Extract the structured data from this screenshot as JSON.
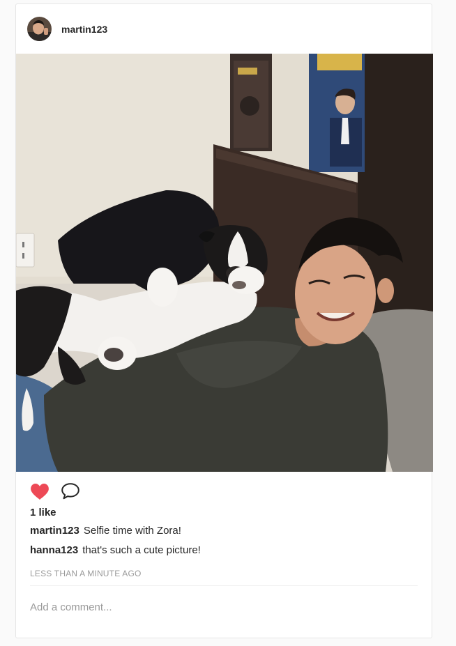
{
  "post": {
    "username": "martin123",
    "avatar_icon": "profile-photo",
    "photo_alt": "",
    "liked": true,
    "like_color": "#ed4956",
    "likes_text": "1 like",
    "comments": [
      {
        "user": "martin123",
        "text": "Selfie time with Zora!"
      },
      {
        "user": "hanna123",
        "text": "that's such a cute picture!"
      }
    ],
    "timestamp": "LESS THAN A MINUTE AGO",
    "comment_placeholder": "Add a comment..."
  },
  "icons": {
    "like": "heart-icon",
    "comment": "comment-bubble-icon"
  }
}
